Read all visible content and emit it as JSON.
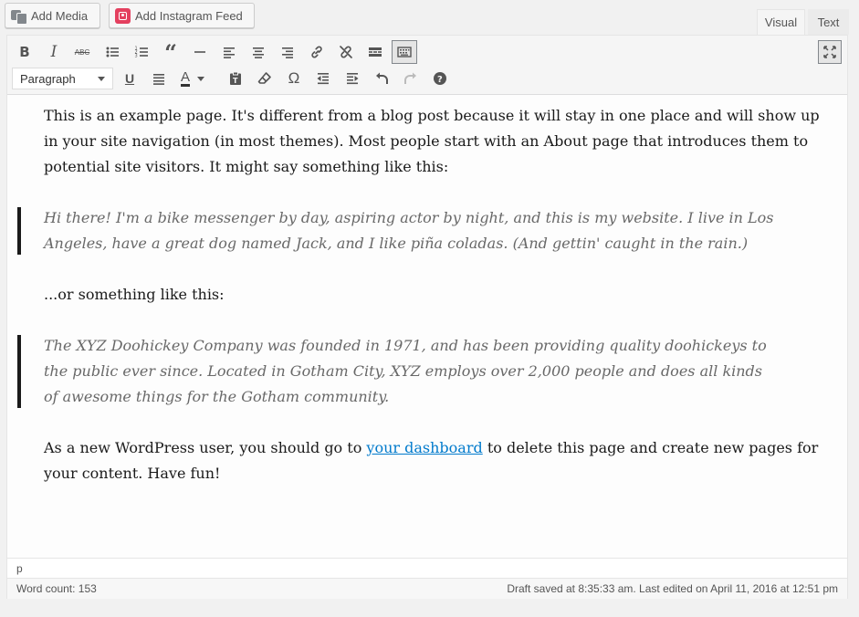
{
  "buttons": {
    "add_media": "Add Media",
    "add_instagram": "Add Instagram Feed"
  },
  "tabs": {
    "visual": "Visual",
    "text": "Text"
  },
  "toolbar": {
    "format_select": "Paragraph",
    "row1_icons": [
      "bold-icon",
      "italic-icon",
      "strikethrough-icon",
      "bullet-list-icon",
      "numbered-list-icon",
      "blockquote-icon",
      "horizontal-rule-icon",
      "align-left-icon",
      "align-center-icon",
      "align-right-icon",
      "insert-link-icon",
      "unlink-icon",
      "read-more-icon",
      "toolbar-toggle-icon"
    ],
    "row2_icons": [
      "underline-icon",
      "justify-icon",
      "text-color-icon",
      "paste-as-text-icon",
      "clear-formatting-icon",
      "special-character-icon",
      "outdent-icon",
      "indent-icon",
      "undo-icon",
      "redo-icon",
      "help-icon"
    ],
    "fullscreen_icon": "fullscreen-icon"
  },
  "content": {
    "p1": "This is an example page. It's different from a blog post because it will stay in one place and will show up in your site navigation (in most themes). Most people start with an About page that introduces them to potential site visitors. It might say something like this:",
    "quote1": "Hi there! I'm a bike messenger by day, aspiring actor by night, and this is my website. I live in Los Angeles, have a great dog named Jack, and I like piña coladas. (And gettin' caught in the rain.)",
    "p2": "...or something like this:",
    "quote2": "The XYZ Doohickey Company was founded in 1971, and has been providing quality doohickeys to the public ever since. Located in Gotham City, XYZ employs over 2,000 people and does all kinds of awesome things for the Gotham community.",
    "p3_before": "As a new WordPress user, you should go to ",
    "p3_link": "your dashboard",
    "p3_after": " to delete this page and create new pages for your content. Have fun!"
  },
  "status": {
    "path": "p",
    "word_count": "Word count: 153",
    "saved": "Draft saved at 8:35:33 am. Last edited on April 11, 2016 at 12:51 pm"
  }
}
